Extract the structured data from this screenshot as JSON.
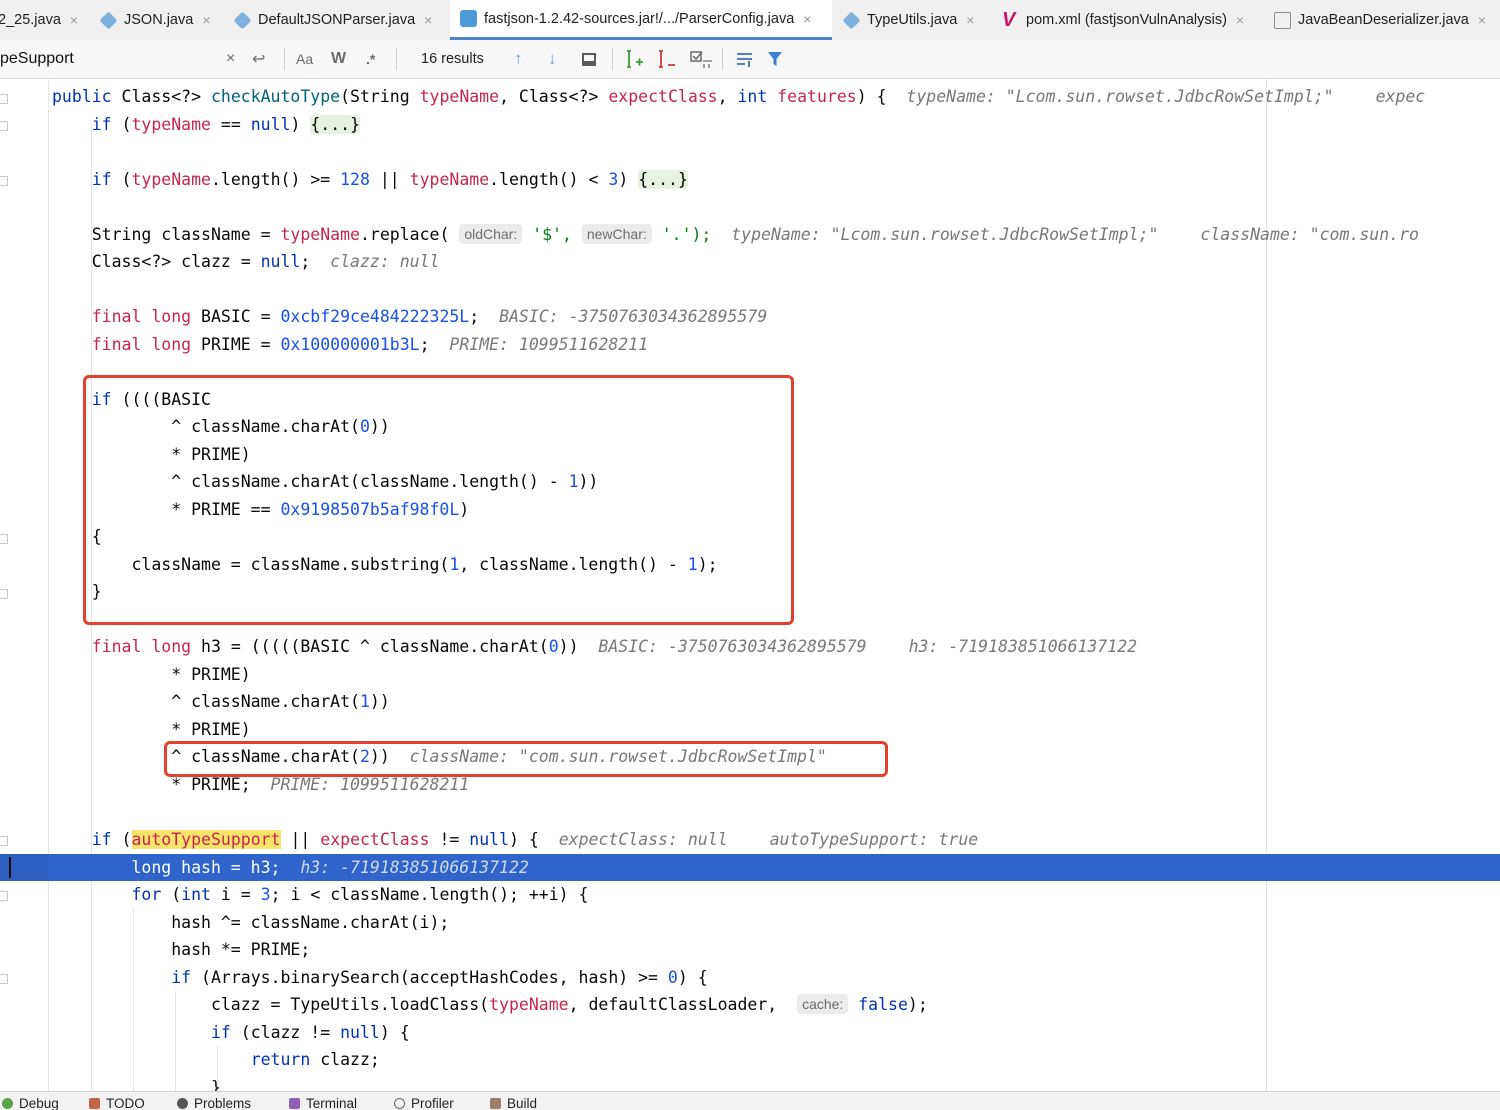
{
  "tabs": [
    {
      "label": "2_25.java",
      "icon": "java-class-icon"
    },
    {
      "label": "JSON.java",
      "icon": "java-class-icon"
    },
    {
      "label": "DefaultJSONParser.java",
      "icon": "java-class-icon"
    },
    {
      "label": "fastjson-1.2.42-sources.jar!/.../ParserConfig.java",
      "icon": "jar-class-icon",
      "active": true
    },
    {
      "label": "TypeUtils.java",
      "icon": "java-class-icon"
    },
    {
      "label": "pom.xml (fastjsonVulnAnalysis)",
      "icon": "maven-icon"
    },
    {
      "label": "JavaBeanDeserializer.java",
      "icon": "decompiled-class-icon"
    }
  ],
  "tab_close": "×",
  "search": {
    "query": "peSupport",
    "clear": "×",
    "enter": "↩",
    "match_case": "Aa",
    "words": "W",
    "regex": ".*",
    "results": "16 results",
    "prev": "↑",
    "next": "↓"
  },
  "code": {
    "l1": {
      "a": "public",
      "b": " Class<?> ",
      "c": "checkAutoType",
      "d": "(String ",
      "e": "typeName",
      "f": ", Class<?> ",
      "g": "expectClass",
      "h": ", ",
      "i": "int",
      "j": " ",
      "k": "features",
      "l": ") {  ",
      "hint1": "typeName: \"Lcom.sun.rowset.JdbcRowSetImpl;\"",
      "hint2": "expec"
    },
    "l2": {
      "a": "    ",
      "b": "if",
      "c": " (",
      "d": "typeName",
      "e": " == ",
      "f": "null",
      "g": ") ",
      "h": "{...}"
    },
    "l3": {
      "a": "    ",
      "b": "if",
      "c": " (",
      "d": "typeName",
      "e": ".length() >= ",
      "f": "128",
      "g": " || ",
      "h": "typeName",
      "i": ".length() < ",
      "j": "3",
      "k": ") ",
      "l": "{...}"
    },
    "l4": {
      "a": "    String className = ",
      "b": "typeName",
      "c": ".replace( ",
      "p1": "oldChar:",
      "d": " '$', ",
      "p2": "newChar:",
      "e": " '.');  ",
      "hint1": "typeName: \"Lcom.sun.rowset.JdbcRowSetImpl;\"",
      "hint2": "className: \"com.sun.ro"
    },
    "l5": {
      "a": "    Class<?> clazz = ",
      "b": "null",
      "c": ";  ",
      "hint": "clazz: null"
    },
    "l6": {
      "a": "    ",
      "b": "final long",
      "c": " BASIC = ",
      "d": "0xcbf29ce484222325L",
      "e": ";  ",
      "hint": "BASIC: -3750763034362895579"
    },
    "l7": {
      "a": "    ",
      "b": "final long",
      "c": " PRIME = ",
      "d": "0x100000001b3L",
      "e": ";  ",
      "hint": "PRIME: 1099511628211"
    },
    "l8": {
      "a": "    ",
      "b": "if",
      "c": " ((((BASIC"
    },
    "l9": {
      "a": "            ^ className.charAt(",
      "b": "0",
      "c": "))"
    },
    "l10": {
      "a": "            * PRIME)"
    },
    "l11": {
      "a": "            ^ className.charAt(className.length() - ",
      "b": "1",
      "c": "))"
    },
    "l12": {
      "a": "            * PRIME == ",
      "b": "0x9198507b5af98f0L",
      "c": ")"
    },
    "l13": {
      "a": "    {"
    },
    "l14": {
      "a": "        className = className.substring(",
      "b": "1",
      "c": ", className.length() - ",
      "d": "1",
      "e": ");"
    },
    "l15": {
      "a": "    }"
    },
    "l16": {
      "a": "    ",
      "b": "final long",
      "c": " h3 = (((((BASIC ^ className.charAt(",
      "d": "0",
      "e": "))  ",
      "hint1": "BASIC: -3750763034362895579",
      "hint2": "h3: -7191838510661371​22"
    },
    "l17": {
      "a": "            * PRIME)"
    },
    "l18": {
      "a": "            ^ className.charAt(",
      "b": "1",
      "c": "))"
    },
    "l19": {
      "a": "            * PRIME)"
    },
    "l20": {
      "a": "            ^ className.charAt(",
      "b": "2",
      "c": "))  ",
      "hint": "className: \"com.sun.rowset.JdbcRowSetImpl\""
    },
    "l21": {
      "a": "            * PRIME;  ",
      "hint": "PRIME: 1099511628211"
    },
    "l22": {
      "a": "    ",
      "b": "if",
      "c": " (",
      "d": "autoTypeSupport",
      "e": " || ",
      "f": "expectClass",
      "g": " != ",
      "h": "null",
      "i": ") {  ",
      "hint1": "expectClass: null",
      "hint2": "autoTypeSupport: true"
    },
    "l23": {
      "a": "        long hash = h3;  ",
      "hint": "h3: -7191838510661371​22"
    },
    "l24": {
      "a": "        ",
      "b": "for",
      "c": " (",
      "d": "int",
      "e": " i = ",
      "f": "3",
      "g": "; i < className.length(); ++i) {"
    },
    "l25": {
      "a": "            hash ^= className.charAt(i);"
    },
    "l26": {
      "a": "            hash *= PRIME;"
    },
    "l27": {
      "a": "            ",
      "b": "if",
      "c": " (Arrays.binarySearch(acceptHashCodes, hash) >= ",
      "d": "0",
      "e": ") {"
    },
    "l28": {
      "a": "                clazz = TypeUtils.loadClass(",
      "b": "typeName",
      "c": ", defaultClassLoader,  ",
      "p": "cache:",
      "d": " ",
      "e": "false",
      "f": ");"
    },
    "l29": {
      "a": "                ",
      "b": "if",
      "c": " (clazz != ",
      "d": "null",
      "e": ") {"
    },
    "l30": {
      "a": "                    ",
      "b": "return",
      "c": " clazz;"
    },
    "l31": {
      "a": "                }"
    }
  },
  "bottom_tools": [
    {
      "label": "Debug",
      "icon": "debug-icon"
    },
    {
      "label": "TODO",
      "icon": "todo-icon"
    },
    {
      "label": "Problems",
      "icon": "problems-icon"
    },
    {
      "label": "Terminal",
      "icon": "terminal-icon"
    },
    {
      "label": "Profiler",
      "icon": "profiler-icon"
    },
    {
      "label": "Build",
      "icon": "build-icon"
    }
  ],
  "colors": {
    "accent": "#4b83cd",
    "current_line": "#2f65ca",
    "annotation_box": "#e0422d",
    "keyword": "#0033b3",
    "field": "#c7254e",
    "number": "#1750eb"
  }
}
